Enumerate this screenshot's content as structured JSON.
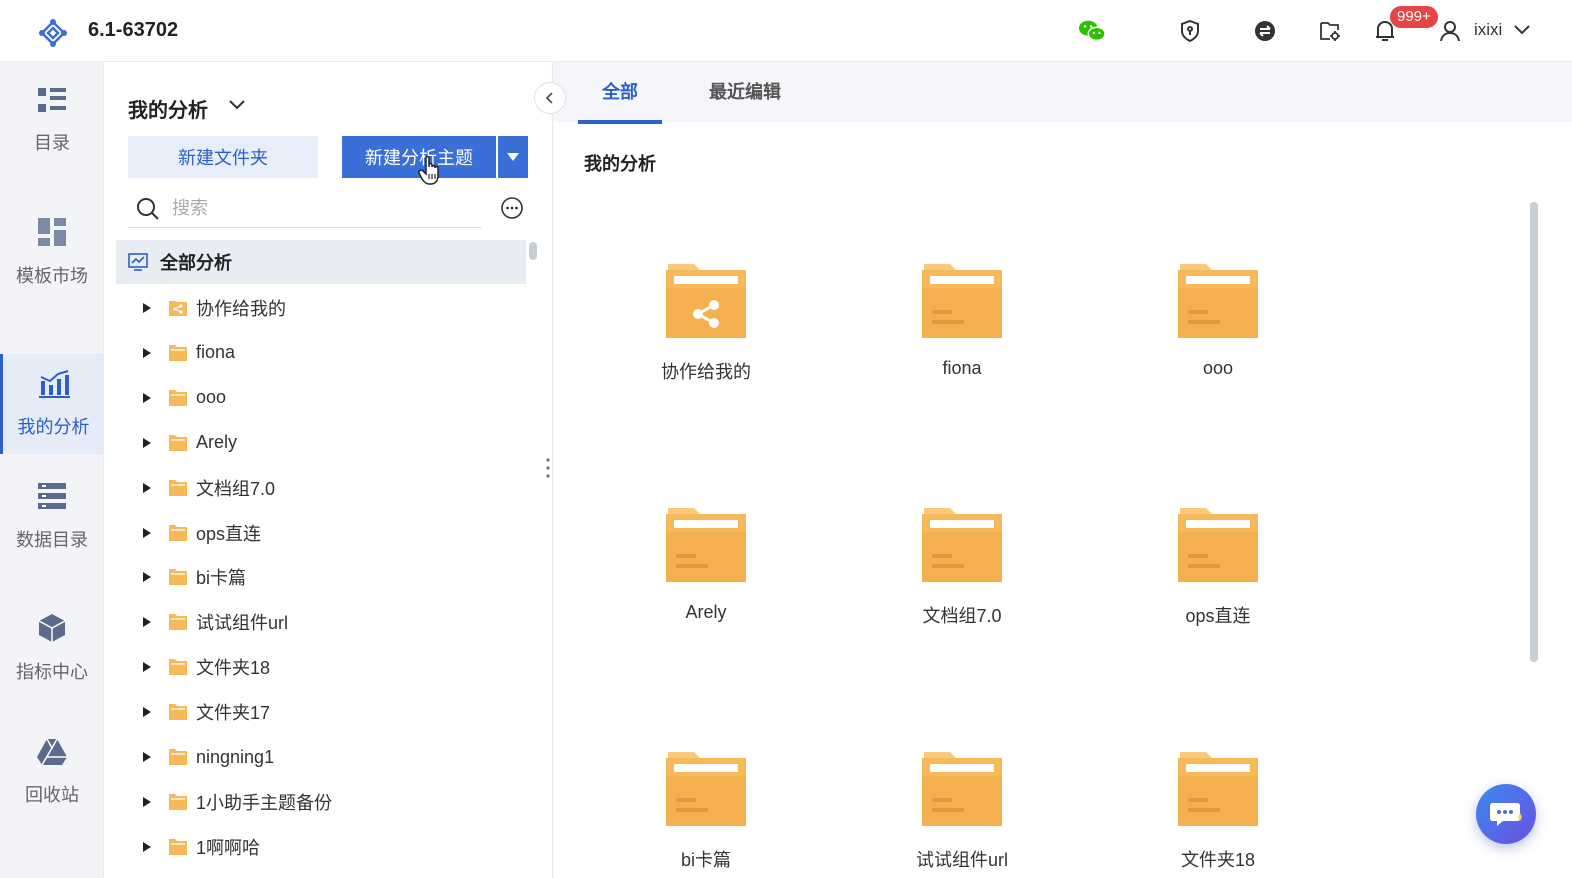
{
  "header": {
    "version": "6.1-63702",
    "notification_badge": "999+",
    "username": "ixixi"
  },
  "leftnav": {
    "items": [
      {
        "label": "目录",
        "icon": "catalog-icon"
      },
      {
        "label": "模板市场",
        "icon": "template-market-icon"
      },
      {
        "label": "我的分析",
        "icon": "my-analysis-icon",
        "active": true
      },
      {
        "label": "数据目录",
        "icon": "data-catalog-icon"
      },
      {
        "label": "指标中心",
        "icon": "metric-center-icon"
      },
      {
        "label": "回收站",
        "icon": "recycle-bin-icon"
      }
    ]
  },
  "treepanel": {
    "title": "我的分析",
    "new_folder_label": "新建文件夹",
    "new_topic_label": "新建分析主题",
    "search_placeholder": "搜索",
    "root_label": "全部分析",
    "items": [
      {
        "label": "协作给我的",
        "shared": true
      },
      {
        "label": "fiona"
      },
      {
        "label": "ooo"
      },
      {
        "label": "Arely"
      },
      {
        "label": "文档组7.0"
      },
      {
        "label": "ops直连"
      },
      {
        "label": "bi卡篇"
      },
      {
        "label": "试试组件url"
      },
      {
        "label": "文件夹18"
      },
      {
        "label": "文件夹17"
      },
      {
        "label": "ningning1"
      },
      {
        "label": "1小助手主题备份"
      },
      {
        "label": "1啊啊哈"
      }
    ]
  },
  "content": {
    "tabs": [
      {
        "label": "全部",
        "active": true
      },
      {
        "label": "最近编辑"
      }
    ],
    "section_title": "我的分析",
    "cards": [
      {
        "label": "协作给我的",
        "shared": true
      },
      {
        "label": "fiona"
      },
      {
        "label": "ooo"
      },
      {
        "label": "Arely"
      },
      {
        "label": "文档组7.0"
      },
      {
        "label": "ops直连"
      },
      {
        "label": "bi卡篇"
      },
      {
        "label": "试试组件url"
      },
      {
        "label": "文件夹18"
      }
    ]
  },
  "colors": {
    "accent": "#2d5fc8",
    "button_primary": "#3a6fd8",
    "folder": "#f5b95a",
    "badge": "#e64545",
    "wechat": "#2dc100"
  }
}
